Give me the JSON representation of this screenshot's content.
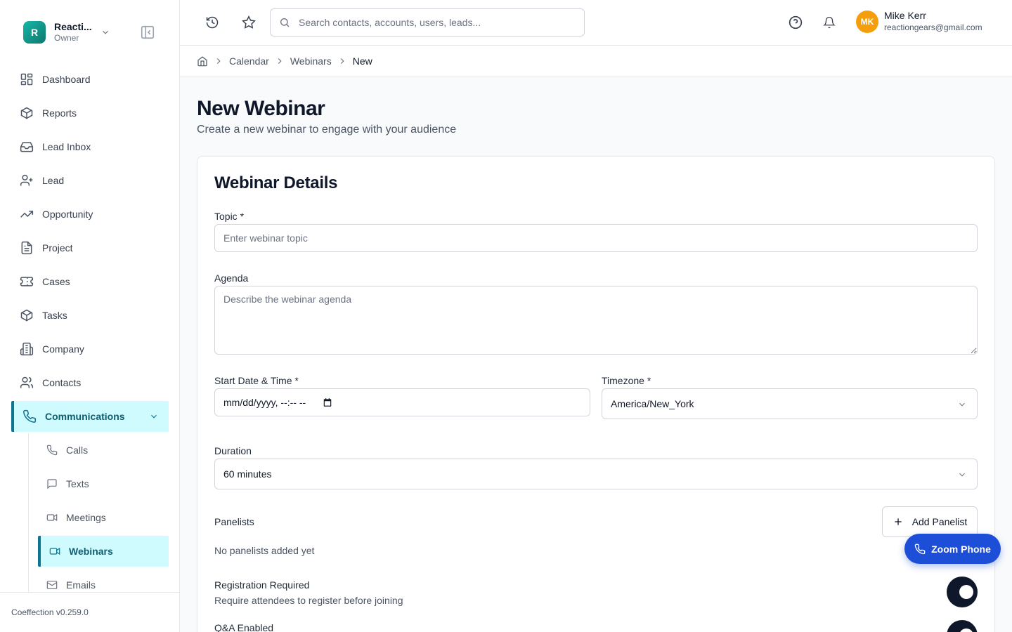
{
  "org": {
    "initial": "R",
    "name": "Reacti...",
    "role": "Owner"
  },
  "nav": {
    "items": [
      {
        "label": "Dashboard",
        "icon": "dashboard-icon"
      },
      {
        "label": "Reports",
        "icon": "box-icon"
      },
      {
        "label": "Lead Inbox",
        "icon": "inbox-icon"
      },
      {
        "label": "Lead",
        "icon": "user-plus-icon"
      },
      {
        "label": "Opportunity",
        "icon": "trending-up-icon"
      },
      {
        "label": "Project",
        "icon": "document-icon"
      },
      {
        "label": "Cases",
        "icon": "ticket-icon"
      },
      {
        "label": "Tasks",
        "icon": "box-icon"
      },
      {
        "label": "Company",
        "icon": "building-icon"
      },
      {
        "label": "Contacts",
        "icon": "users-icon"
      }
    ],
    "communications": {
      "label": "Communications",
      "icon": "phone-icon"
    },
    "sub_items": [
      {
        "label": "Calls",
        "icon": "phone-icon"
      },
      {
        "label": "Texts",
        "icon": "message-icon"
      },
      {
        "label": "Meetings",
        "icon": "video-icon"
      },
      {
        "label": "Webinars",
        "icon": "video-icon"
      },
      {
        "label": "Emails",
        "icon": "mail-icon"
      }
    ]
  },
  "version": "Coeffection v0.259.0",
  "header": {
    "search_placeholder": "Search contacts, accounts, users, leads...",
    "user": {
      "initials": "MK",
      "name": "Mike Kerr",
      "email": "reactiongears@gmail.com"
    }
  },
  "breadcrumb": {
    "items": [
      "Calendar",
      "Webinars"
    ],
    "current": "New"
  },
  "page": {
    "title": "New Webinar",
    "subtitle": "Create a new webinar to engage with your audience"
  },
  "form": {
    "card_title": "Webinar Details",
    "topic_label": "Topic *",
    "topic_placeholder": "Enter webinar topic",
    "agenda_label": "Agenda",
    "agenda_placeholder": "Describe the webinar agenda",
    "start_label": "Start Date & Time *",
    "start_value": "mm/dd/yyyy, --:-- --",
    "timezone_label": "Timezone *",
    "timezone_value": "America/New_York",
    "duration_label": "Duration",
    "duration_value": "60 minutes",
    "panelists_label": "Panelists",
    "add_panelist": "Add Panelist",
    "no_panelists": "No panelists added yet",
    "registration_label": "Registration Required",
    "registration_desc": "Require attendees to register before joining",
    "qa_label": "Q&A Enabled"
  },
  "zoom_phone": "Zoom Phone",
  "colors": {
    "accent": "#0e7490",
    "active_bg": "#cffafe",
    "avatar": "#f59e0b",
    "zoom": "#1d4ed8",
    "toggle": "#0f172a"
  }
}
